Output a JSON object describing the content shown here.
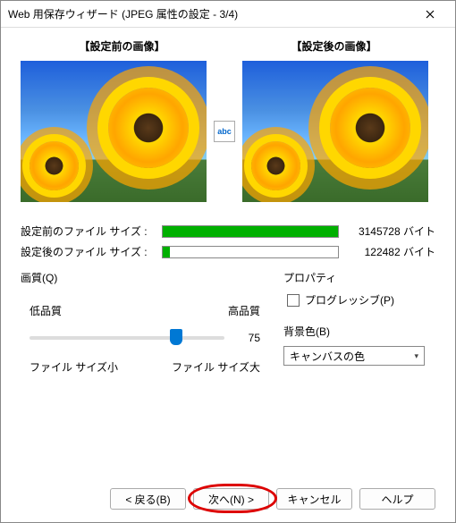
{
  "window": {
    "title": "Web 用保存ウィザード (JPEG 属性の設定 - 3/4)"
  },
  "preview": {
    "before_label": "【設定前の画像】",
    "after_label": "【設定後の画像】",
    "swap_icon": "abc"
  },
  "sizes": {
    "before_label": "設定前のファイル サイズ :",
    "after_label": "設定後のファイル サイズ :",
    "before_value": "3145728 バイト",
    "after_value": "122482 バイト",
    "before_pct": 100,
    "after_pct": 4
  },
  "quality": {
    "group": "画質(Q)",
    "low": "低品質",
    "high": "高品質",
    "value": "75",
    "slider_pct": 75,
    "fs_small": "ファイル サイズ小",
    "fs_large": "ファイル サイズ大"
  },
  "property": {
    "group": "プロパティ",
    "progressive": "プログレッシブ(P)",
    "bg_label": "背景色(B)",
    "bg_value": "キャンバスの色"
  },
  "buttons": {
    "back": "< 戻る(B)",
    "next": "次へ(N) >",
    "cancel": "キャンセル",
    "help": "ヘルプ"
  }
}
